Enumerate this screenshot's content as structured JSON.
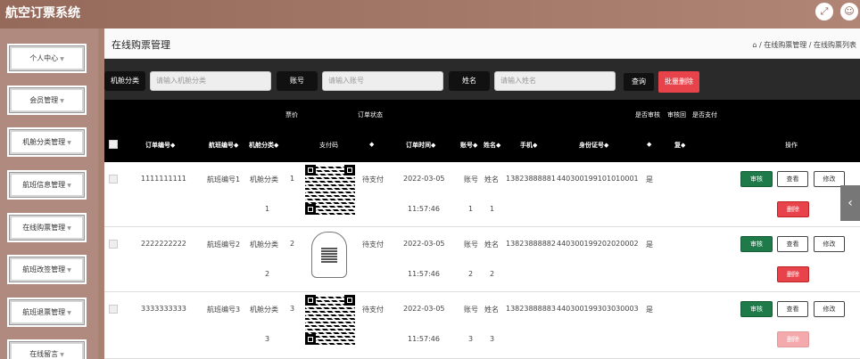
{
  "app": {
    "title": "航空订票系统",
    "fullscreen_icon": "expand-icon",
    "user_icon": "user-icon"
  },
  "sidebar": {
    "items": [
      {
        "label": "个人中心"
      },
      {
        "label": "会员管理"
      },
      {
        "label": "机舱分类管理"
      },
      {
        "label": "航班信息管理"
      },
      {
        "label": "在线购票管理"
      },
      {
        "label": "航班改签管理"
      },
      {
        "label": "航班退票管理"
      },
      {
        "label": "在线留言"
      }
    ]
  },
  "page": {
    "title": "在线购票管理",
    "crumb1": "在线购票管理",
    "crumb2": "在线购票列表",
    "sep": "/",
    "home_icon": "home-icon"
  },
  "filter": {
    "label1": "机舱分类",
    "ph1": "请输入机舱分类",
    "label2": "账号",
    "ph2": "请输入账号",
    "label3": "姓名",
    "ph3": "请输入姓名",
    "search": "查询",
    "batch_delete": "批量删除"
  },
  "table": {
    "top_headers": {
      "price": "票价",
      "order_status": "订单状态",
      "audit": "是否审核",
      "audit_reply": "审核回",
      "paid": "是否支付"
    },
    "headers": [
      "订单编号",
      "航班编号",
      "机舱分类",
      "支付码",
      "",
      "订单时间",
      "账号",
      "姓名",
      "手机",
      "身份证号",
      "",
      "复",
      "操作"
    ],
    "sort_glyph": "◆"
  },
  "rows": [
    {
      "order_no": "1111111111",
      "flight": "航班编号1",
      "cabin": "机舱分类",
      "price_a": "1",
      "price_b": "1",
      "status": "待支付",
      "date": "2022-03-05",
      "time": "11:57:46",
      "acct_a": "账号",
      "acct_b": "1",
      "name_a": "姓名",
      "name_b": "1",
      "phone": "13823888881",
      "idno": "440300199101010001",
      "audit": "是"
    },
    {
      "order_no": "2222222222",
      "flight": "航班编号2",
      "cabin": "机舱分类",
      "price_a": "2",
      "price_b": "2",
      "status": "待支付",
      "date": "2022-03-05",
      "time": "11:57:46",
      "acct_a": "账号",
      "acct_b": "2",
      "name_a": "姓名",
      "name_b": "2",
      "phone": "13823888882",
      "idno": "440300199202020002",
      "audit": "是"
    },
    {
      "order_no": "3333333333",
      "flight": "航班编号3",
      "cabin": "机舱分类",
      "price_a": "3",
      "price_b": "3",
      "status": "待支付",
      "date": "2022-03-05",
      "time": "11:57:46",
      "acct_a": "账号",
      "acct_b": "3",
      "name_a": "姓名",
      "name_b": "3",
      "phone": "13823888883",
      "idno": "440300199303030003",
      "audit": "是"
    }
  ],
  "actions": {
    "audit": "审核",
    "view": "查看",
    "edit": "修改",
    "delete": "删除"
  }
}
